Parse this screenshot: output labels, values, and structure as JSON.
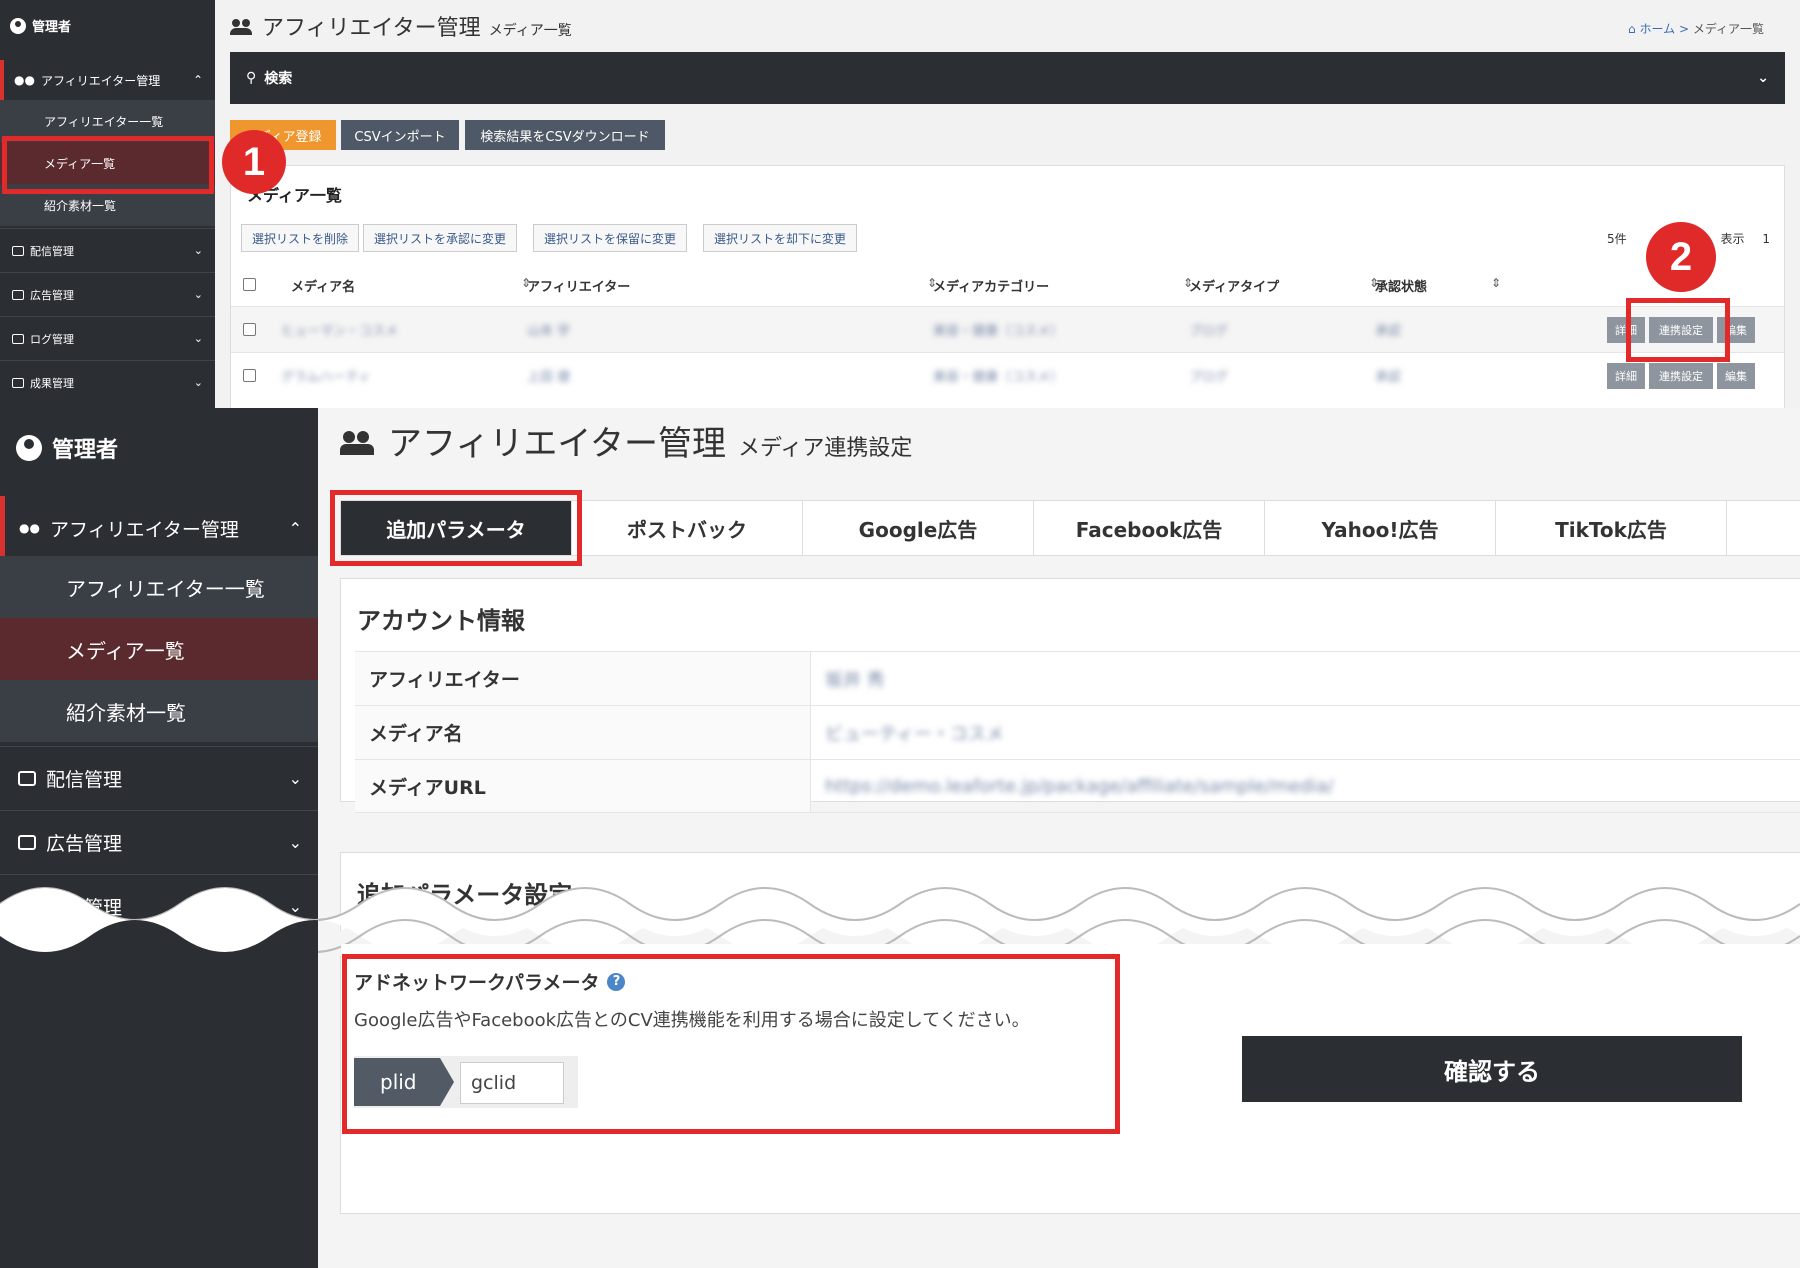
{
  "callouts": {
    "one": "1",
    "two": "2"
  },
  "top": {
    "sidebar": {
      "user": "管理者",
      "affiliate_header": "アフィリエイター管理",
      "sub_items": [
        "アフィリエイター一覧",
        "メディア一覧",
        "紹介素材一覧"
      ],
      "menus": [
        "配信管理",
        "広告管理",
        "ログ管理",
        "成果管理"
      ]
    },
    "title": "アフィリエイター管理",
    "subtitle": "メディア一覧",
    "breadcrumb": {
      "home": "ホーム >",
      "current": "メディア一覧"
    },
    "search_label": "検索",
    "buttons": {
      "register": "メディア登録",
      "csv_import": "CSVインポート",
      "csv_download": "検索結果をCSVダウンロード"
    },
    "panel_title": "メディア一覧",
    "bulk_buttons": [
      "選択リストを削除",
      "選択リストを承認に変更",
      "選択リストを保留に変更",
      "選択リストを却下に変更"
    ],
    "paging": {
      "left": "5件",
      "right": "表示",
      "page": "1"
    },
    "columns": [
      "メディア名",
      "アフィリエイター",
      "メディアカテゴリー",
      "メディアタイプ",
      "承認状態"
    ],
    "rows": [
      {
        "media": "ヒューマン・コスメ",
        "affiliate": "山本 学",
        "category": "美容・健康（コスメ）",
        "type": "ブログ",
        "status": "承認"
      },
      {
        "media": "グラムハーティ",
        "affiliate": "上田 健",
        "category": "美容・健康（コスメ）",
        "type": "ブログ",
        "status": "承認"
      }
    ],
    "row_actions": {
      "detail": "詳細",
      "link": "連携設定",
      "edit": "編集"
    }
  },
  "bottom": {
    "sidebar": {
      "user": "管理者",
      "affiliate_header": "アフィリエイター管理",
      "sub_items": [
        "アフィリエイター一覧",
        "メディア一覧",
        "紹介素材一覧"
      ],
      "menus": [
        "配信管理",
        "広告管理",
        "ログ管理"
      ]
    },
    "title": "アフィリエイター管理",
    "subtitle": "メディア連携設定",
    "tabs": [
      "追加パラメータ",
      "ポストバック",
      "Google広告",
      "Facebook広告",
      "Yahoo!広告",
      "TikTok広告"
    ],
    "account": {
      "title": "アカウント情報",
      "rows": [
        {
          "label": "アフィリエイター",
          "value": "坂井 秀"
        },
        {
          "label": "メディア名",
          "value": "ビューティー・コスメ"
        },
        {
          "label": "メディアURL",
          "value": "https://demo.leaforte.jp/package/affiliate/sample/media/"
        }
      ]
    },
    "params": {
      "title": "追加パラメータ設定",
      "label": "アドネットワークパラメータ",
      "help": "?",
      "description": "Google広告やFacebook広告とのCV連携機能を利用する場合に設定してください。",
      "key": "plid",
      "value": "gclid"
    },
    "confirm": "確認する"
  },
  "colors": {
    "accent_red": "#e32a2a",
    "sidebar": "#2b2e33",
    "active_item": "#5a2a2e",
    "register_orange": "#f0962e",
    "button_slate": "#4f5866"
  }
}
